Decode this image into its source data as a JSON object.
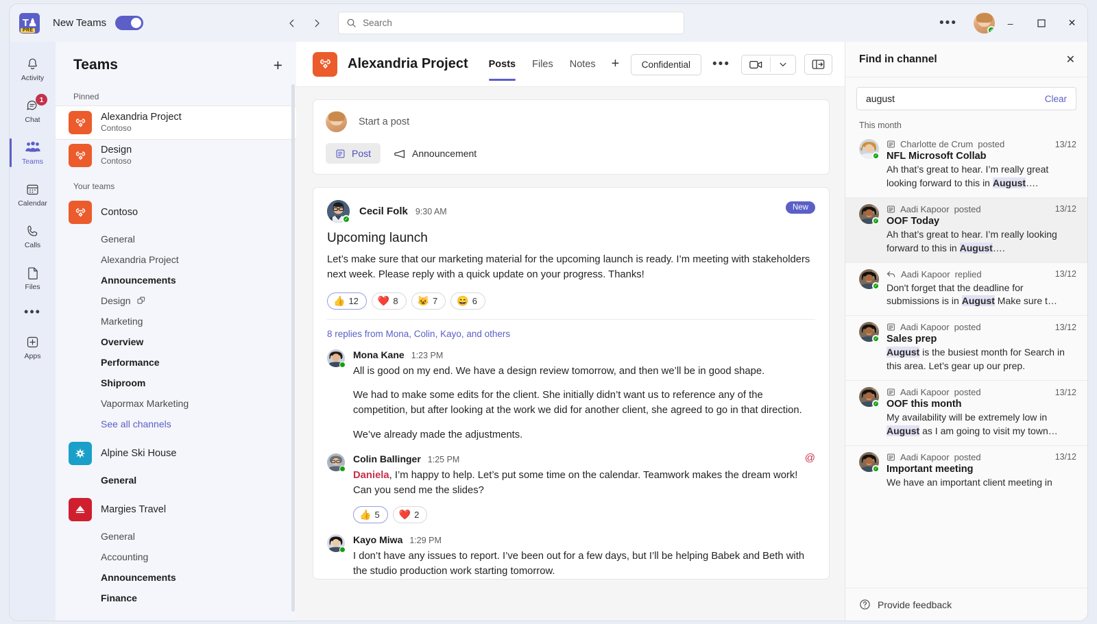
{
  "titlebar": {
    "logo_label": "teams-logo",
    "logo_badge": "PRE",
    "new_teams_label": "New Teams",
    "toggle_state": "on",
    "back_icon": "chevron-left-icon",
    "forward_icon": "chevron-right-icon",
    "search_placeholder": "Search",
    "more_label": "•••",
    "minimize": "–",
    "maximize": "☐",
    "close": "✕"
  },
  "rail": {
    "items": [
      {
        "label": "Activity",
        "icon": "bell-icon",
        "badge": "",
        "active": false
      },
      {
        "label": "Chat",
        "icon": "chat-icon",
        "badge": "1",
        "active": false
      },
      {
        "label": "Teams",
        "icon": "people-icon",
        "badge": "",
        "active": true
      },
      {
        "label": "Calendar",
        "icon": "calendar-icon",
        "badge": "",
        "active": false
      },
      {
        "label": "Calls",
        "icon": "phone-icon",
        "badge": "",
        "active": false
      },
      {
        "label": "Files",
        "icon": "file-icon",
        "badge": "",
        "active": false
      }
    ],
    "more_label": "•••",
    "apps": {
      "label": "Apps",
      "icon": "apps-plus-icon"
    }
  },
  "teams_panel": {
    "title": "Teams",
    "add_label": "+",
    "pinned_header": "Pinned",
    "pinned": [
      {
        "name": "Alexandria Project",
        "org": "Contoso",
        "tile": "contoso",
        "selected": true
      },
      {
        "name": "Design",
        "org": "Contoso",
        "tile": "contoso",
        "selected": false
      }
    ],
    "your_teams_header": "Your teams",
    "teams": [
      {
        "name": "Contoso",
        "tile": "contoso",
        "channels": [
          {
            "label": "General",
            "bold": false,
            "shared": false,
            "link": false
          },
          {
            "label": "Alexandria Project",
            "bold": false,
            "shared": false,
            "link": false
          },
          {
            "label": "Announcements",
            "bold": true,
            "shared": false,
            "link": false
          },
          {
            "label": "Design",
            "bold": false,
            "shared": true,
            "link": false
          },
          {
            "label": "Marketing",
            "bold": false,
            "shared": false,
            "link": false
          },
          {
            "label": "Overview",
            "bold": true,
            "shared": false,
            "link": false
          },
          {
            "label": "Performance",
            "bold": true,
            "shared": false,
            "link": false
          },
          {
            "label": "Shiproom",
            "bold": true,
            "shared": false,
            "link": false
          },
          {
            "label": "Vapormax Marketing",
            "bold": false,
            "shared": false,
            "link": false
          },
          {
            "label": "See all channels",
            "bold": false,
            "shared": false,
            "link": true
          }
        ]
      },
      {
        "name": "Alpine Ski House",
        "tile": "alpine",
        "channels": [
          {
            "label": "General",
            "bold": true,
            "shared": false,
            "link": false
          }
        ]
      },
      {
        "name": "Margies Travel",
        "tile": "margies",
        "channels": [
          {
            "label": "General",
            "bold": false,
            "shared": false,
            "link": false
          },
          {
            "label": "Accounting",
            "bold": false,
            "shared": false,
            "link": false
          },
          {
            "label": "Announcements",
            "bold": true,
            "shared": false,
            "link": false
          },
          {
            "label": "Finance",
            "bold": true,
            "shared": false,
            "link": false
          }
        ]
      }
    ]
  },
  "channel_header": {
    "title": "Alexandria Project",
    "tabs": [
      {
        "label": "Posts",
        "active": true
      },
      {
        "label": "Files",
        "active": false
      },
      {
        "label": "Notes",
        "active": false
      }
    ],
    "add_tab_label": "+",
    "sensitivity_label": "Confidential",
    "more_label": "•••",
    "meet_icon": "video-camera-icon",
    "meet_chevron_icon": "chevron-down-icon",
    "panel_icon": "open-side-panel-icon"
  },
  "composer": {
    "placeholder": "Start a post",
    "post_label": "Post",
    "post_icon": "post-icon",
    "announcement_label": "Announcement",
    "announcement_icon": "megaphone-icon"
  },
  "post": {
    "author": "Cecil Folk",
    "time": "9:30 AM",
    "new_badge": "New",
    "title": "Upcoming launch",
    "body": "Let’s make sure that our marketing material for the upcoming launch is ready. I’m meeting with stakeholders next week. Please reply with a quick update on your progress. Thanks!",
    "reactions": [
      {
        "emoji": "👍",
        "count": "12",
        "highlighted": true
      },
      {
        "emoji": "❤️",
        "count": "8",
        "highlighted": false
      },
      {
        "emoji": "😺",
        "count": "7",
        "highlighted": false
      },
      {
        "emoji": "😄",
        "count": "6",
        "highlighted": false
      }
    ],
    "replies_summary": "8 replies from Mona, Colin, Kayo, and others",
    "replies": [
      {
        "author": "Mona Kane",
        "time": "1:23 PM",
        "paragraphs": [
          "All is good on my end. We have a design review tomorrow, and then we’ll be in good shape.",
          "We had to make some edits for the client. She initially didn’t want us to reference any of the competition, but after looking at the work we did for another client, she agreed to go in that direction.",
          "We’ve already made the adjustments."
        ],
        "mention": "",
        "mention_flag": false,
        "reactions": []
      },
      {
        "author": "Colin Ballinger",
        "time": "1:25 PM",
        "mention": "Daniela",
        "mention_flag": true,
        "paragraphs": [
          ", I’m happy to help. Let’s put some time on the calendar. Teamwork makes the dream work! Can you send me the slides?"
        ],
        "reactions": [
          {
            "emoji": "👍",
            "count": "5",
            "highlighted": true
          },
          {
            "emoji": "❤️",
            "count": "2",
            "highlighted": false
          }
        ]
      },
      {
        "author": "Kayo Miwa",
        "time": "1:29 PM",
        "mention": "",
        "mention_flag": false,
        "paragraphs": [
          "I don’t have any issues to report. I’ve been out for a few days, but I’ll be helping Babek and Beth with the studio production work starting tomorrow."
        ],
        "reactions": []
      }
    ]
  },
  "find_panel": {
    "title": "Find in channel",
    "close_label": "✕",
    "query": "august",
    "clear_label": "Clear",
    "group_label": "This month",
    "results": [
      {
        "author": "Charlotte de Crum",
        "action": "posted",
        "action_icon": "post-icon",
        "date": "13/12",
        "title": "NFL Microsoft Collab",
        "snippet_before": "Ah that’s great to hear. I’m really great looking forward to this in ",
        "highlight": "August",
        "snippet_after": "….",
        "hovered": false
      },
      {
        "author": "Aadi Kapoor",
        "action": "posted",
        "action_icon": "post-icon",
        "date": "13/12",
        "title": "OOF Today",
        "snippet_before": "Ah that’s great to hear. I’m really looking forward to this in ",
        "highlight": "August",
        "snippet_after": "….",
        "hovered": true
      },
      {
        "author": "Aadi Kapoor",
        "action": "replied",
        "action_icon": "reply-arrow-icon",
        "date": "13/12",
        "title": "",
        "snippet_before": "Don't forget that the deadline for submissions is in ",
        "highlight": "August",
        "snippet_after": " Make sure t…",
        "hovered": false
      },
      {
        "author": "Aadi Kapoor",
        "action": "posted",
        "action_icon": "post-icon",
        "date": "13/12",
        "title": "Sales prep",
        "snippet_before": "",
        "highlight": "August",
        "snippet_after": " is the busiest month for Search in this area. Let’s gear up our prep.",
        "hovered": false
      },
      {
        "author": "Aadi Kapoor",
        "action": "posted",
        "action_icon": "post-icon",
        "date": "13/12",
        "title": "OOF this month",
        "snippet_before": "My availability will be extremely low in ",
        "highlight": "August",
        "snippet_after": " as I am going to visit my town…",
        "hovered": false
      },
      {
        "author": "Aadi Kapoor",
        "action": "posted",
        "action_icon": "post-icon",
        "date": "13/12",
        "title": "Important meeting",
        "snippet_before": "We have an important client meeting in",
        "highlight": "",
        "snippet_after": "",
        "hovered": false
      }
    ],
    "feedback_label": "Provide feedback",
    "feedback_icon": "question-circle-icon"
  },
  "colors": {
    "accent": "#5b5fc7",
    "contoso_tile": "#ec5b2b",
    "alpine_tile": "#1aa0c8",
    "margies_tile": "#cf1f2e",
    "badge_red": "#c4314b",
    "presence_green": "#13a10e",
    "highlight": "#e2e2f5"
  }
}
